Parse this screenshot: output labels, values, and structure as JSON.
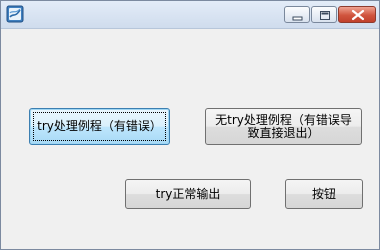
{
  "window": {
    "controls": {
      "minimize_icon": "minimize-icon",
      "maximize_icon": "maximize-icon",
      "close_icon": "close-icon"
    }
  },
  "buttons": {
    "try_error_label": "try处理例程（有错误）",
    "no_try_label": "无try处理例程（有错误导致直接退出）",
    "try_ok_label": "try正常输出",
    "button_label": "按钮"
  },
  "colors": {
    "window_bg": "#f0f0f0",
    "titlebar": "#dbe6f4",
    "close_button": "#c94a35",
    "focused_button_border": "#3c7fb1"
  }
}
